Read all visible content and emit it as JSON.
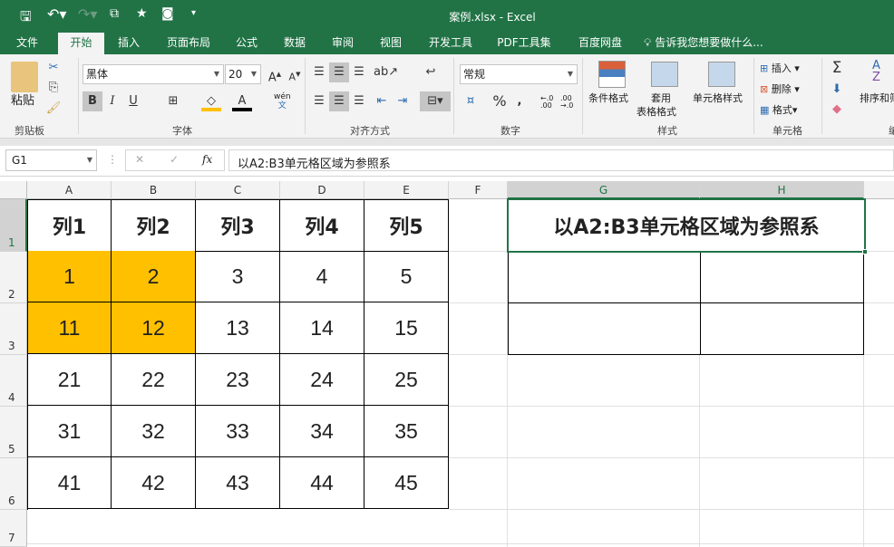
{
  "window": {
    "title": "案例.xlsx - Excel"
  },
  "tabs": [
    "文件",
    "开始",
    "插入",
    "页面布局",
    "公式",
    "数据",
    "审阅",
    "视图",
    "开发工具",
    "PDF工具集",
    "百度网盘"
  ],
  "tell_me": "告诉我您想要做什么...",
  "ribbon": {
    "clipboard": {
      "paste": "粘贴",
      "label": "剪贴板"
    },
    "font": {
      "name": "黑体",
      "size": "20",
      "bold": "B",
      "italic": "I",
      "underline": "U",
      "phonetic": "wén",
      "label": "字体"
    },
    "alignment": {
      "label": "对齐方式"
    },
    "number": {
      "format": "常规",
      "percent": "%",
      "comma": ",",
      "inc_decimal": "←.0 .00",
      "dec_decimal": ".00 →.0",
      "label": "数字"
    },
    "styles": {
      "conditional": "条件格式",
      "table1": "套用",
      "table2": "表格格式",
      "cell_styles": "单元格样式",
      "label": "样式"
    },
    "cells": {
      "insert": "插入",
      "delete": "删除",
      "format": "格式",
      "label": "单元格"
    },
    "editing": {
      "sort": "排序和筛",
      "label": "编"
    }
  },
  "formula_bar": {
    "name_box": "G1",
    "fx": "fx",
    "content": "以A2:B3单元格区域为参照系"
  },
  "columns": [
    "A",
    "B",
    "C",
    "D",
    "E",
    "F",
    "G",
    "H"
  ],
  "rows": [
    "1",
    "2",
    "3",
    "4",
    "5",
    "6",
    "7"
  ],
  "table": {
    "headers": [
      "列1",
      "列2",
      "列3",
      "列4",
      "列5"
    ],
    "data": [
      [
        "1",
        "2",
        "3",
        "4",
        "5"
      ],
      [
        "11",
        "12",
        "13",
        "14",
        "15"
      ],
      [
        "21",
        "22",
        "23",
        "24",
        "25"
      ],
      [
        "31",
        "32",
        "33",
        "34",
        "35"
      ],
      [
        "41",
        "42",
        "43",
        "44",
        "45"
      ]
    ]
  },
  "note": "以A2:B3单元格区域为参照系",
  "colors": {
    "accent": "#217346",
    "highlight": "#ffc000"
  }
}
